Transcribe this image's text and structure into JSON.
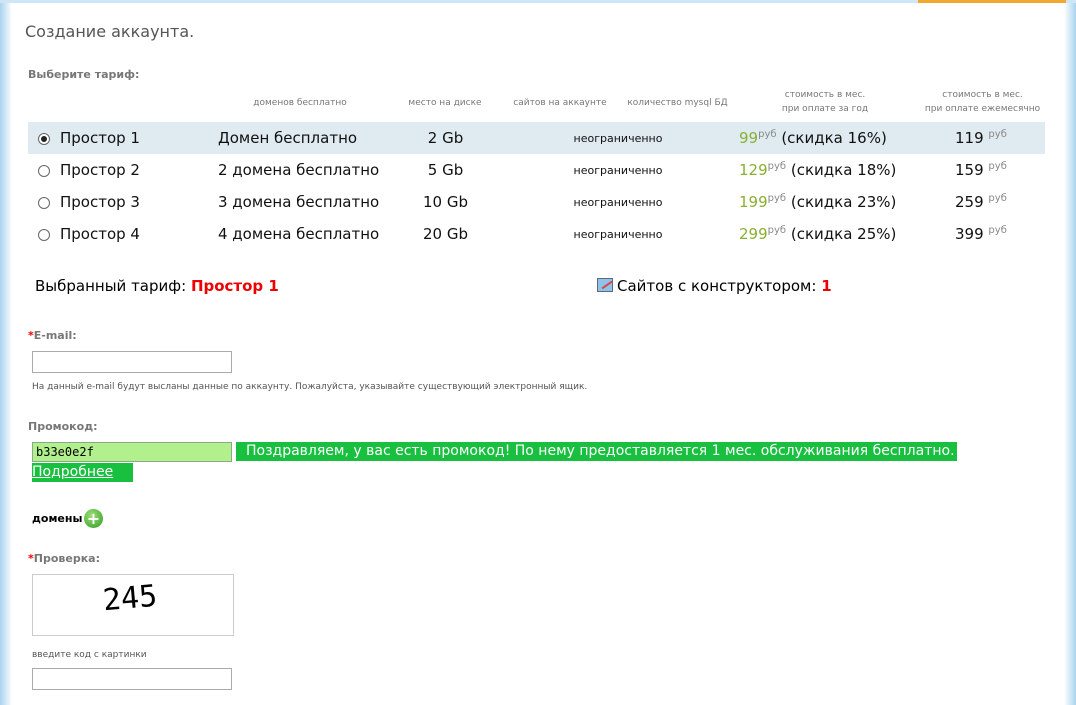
{
  "title": "Создание аккаунта.",
  "choose_label": "Выберите тариф:",
  "columns": {
    "domains": "доменов бесплатно",
    "disk": "место на диске",
    "sites": "сайтов на аккаунте",
    "mysql": "количество mysql БД",
    "year1": "стоимость в мес.",
    "year2": "при оплате за год",
    "month1": "стоимость в мес.",
    "month2": "при оплате ежемесячно"
  },
  "currency": "руб",
  "plans": [
    {
      "name": "Простор 1",
      "domains": "Домен бесплатно",
      "disk": "2 Gb",
      "sites": "неограниченно",
      "year_price": "99",
      "discount": "(скидка 16%)",
      "month_price": "119",
      "selected": true
    },
    {
      "name": "Простор 2",
      "domains": "2 домена бесплатно",
      "disk": "5 Gb",
      "sites": "неограниченно",
      "year_price": "129",
      "discount": "(скидка 18%)",
      "month_price": "159",
      "selected": false
    },
    {
      "name": "Простор 3",
      "domains": "3 домена бесплатно",
      "disk": "10 Gb",
      "sites": "неограниченно",
      "year_price": "199",
      "discount": "(скидка 23%)",
      "month_price": "259",
      "selected": false
    },
    {
      "name": "Простор 4",
      "domains": "4 домена бесплатно",
      "disk": "20 Gb",
      "sites": "неограниченно",
      "year_price": "299",
      "discount": "(скидка 25%)",
      "month_price": "399",
      "selected": false
    }
  ],
  "selected_label": "Выбранный тариф:",
  "selected_value": "Простор 1",
  "builder_label": "Сайтов с конструктором:",
  "builder_value": "1",
  "email_label": "E-mail:",
  "email_value": "",
  "email_hint": "На данный e-mail будут высланы данные по аккаунту. Пожалуйста, указывайте существующий электронный ящик.",
  "promo_label": "Промокод:",
  "promo_value": "b33e0e2f",
  "promo_message": "Поздравляем, у вас есть промокод! По нему предоставляется 1 мес. обслуживания бесплатно.",
  "promo_more": "Подробнее",
  "domains_label": "домены",
  "check_label": "Проверка:",
  "captcha_text": "245",
  "captcha_hint": "введите код с картинки",
  "captcha_value": "",
  "required_mark": "*"
}
